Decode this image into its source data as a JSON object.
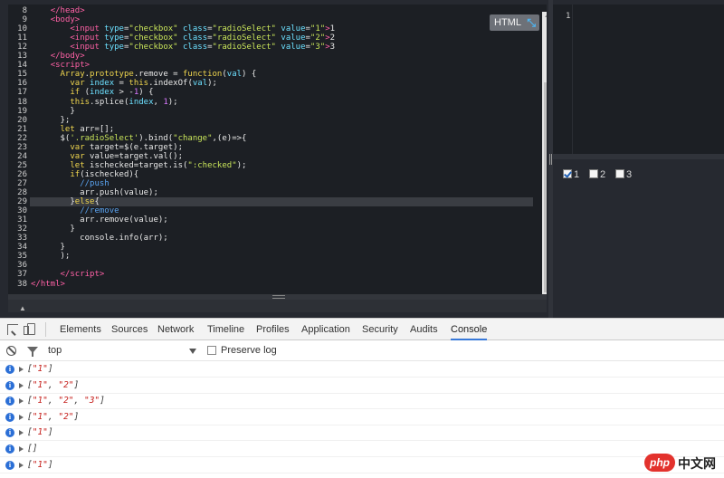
{
  "editor": {
    "lines": [
      {
        "n": "8",
        "html": "    <span class=\"t\">&lt;/head&gt;</span>"
      },
      {
        "n": "9",
        "html": "    <span class=\"t\">&lt;body&gt;</span>"
      },
      {
        "n": "10",
        "html": "        <span class=\"t\">&lt;input</span> <span class=\"a\">type</span>=<span class=\"s\">\"checkbox\"</span> <span class=\"a\">class</span>=<span class=\"s\">\"radioSelect\"</span> <span class=\"a\">value</span>=<span class=\"s\">\"1\"</span><span class=\"t\">&gt;</span>1"
      },
      {
        "n": "11",
        "html": "        <span class=\"t\">&lt;input</span> <span class=\"a\">type</span>=<span class=\"s\">\"checkbox\"</span> <span class=\"a\">class</span>=<span class=\"s\">\"radioSelect\"</span> <span class=\"a\">value</span>=<span class=\"s\">\"2\"</span><span class=\"t\">&gt;</span>2"
      },
      {
        "n": "12",
        "html": "        <span class=\"t\">&lt;input</span> <span class=\"a\">type</span>=<span class=\"s\">\"checkbox\"</span> <span class=\"a\">class</span>=<span class=\"s\">\"radioSelect\"</span> <span class=\"a\">value</span>=<span class=\"s\">\"3\"</span><span class=\"t\">&gt;</span>3"
      },
      {
        "n": "13",
        "html": "    <span class=\"t\">&lt;/body&gt;</span>"
      },
      {
        "n": "14",
        "html": "    <span class=\"t\">&lt;script&gt;</span>"
      },
      {
        "n": "15",
        "html": "      <span class=\"k\">Array</span>.<span class=\"k\">prototype</span>.remove = <span class=\"k\">function</span>(<span class=\"a\">val</span>) {"
      },
      {
        "n": "16",
        "html": "        <span class=\"k\">var</span> <span class=\"a\">index</span> = <span class=\"k\">this</span>.indexOf(<span class=\"a\">val</span>);"
      },
      {
        "n": "17",
        "html": "        <span class=\"k\">if</span> (<span class=\"a\">index</span> &gt; -<span class=\"nm\">1</span>) {"
      },
      {
        "n": "18",
        "html": "        <span class=\"k\">this</span>.splice(<span class=\"a\">index</span>, <span class=\"nm\">1</span>);"
      },
      {
        "n": "19",
        "html": "        }"
      },
      {
        "n": "20",
        "html": "      };"
      },
      {
        "n": "21",
        "html": "      <span class=\"k\">let</span> arr=[];"
      },
      {
        "n": "22",
        "html": "      $(<span class=\"s\">'.radioSelect'</span>).bind(<span class=\"s\">\"change\"</span>,(e)=&gt;{"
      },
      {
        "n": "23",
        "html": "        <span class=\"k\">var</span> target=$(e.target);"
      },
      {
        "n": "24",
        "html": "        <span class=\"k\">var</span> value=target.val();"
      },
      {
        "n": "25",
        "html": "        <span class=\"k\">let</span> ischecked=target.is(<span class=\"s\">\":checked\"</span>);"
      },
      {
        "n": "26",
        "html": "        <span class=\"k\">if</span>(ischecked){"
      },
      {
        "n": "27",
        "html": "          <span class=\"cm\">//push</span>"
      },
      {
        "n": "28",
        "html": "          arr.push(value);"
      },
      {
        "n": "29",
        "html": "        }<span class=\"k\">else</span>{",
        "active": true
      },
      {
        "n": "30",
        "html": "          <span class=\"cm\">//remove</span>"
      },
      {
        "n": "31",
        "html": "          arr.remove(value);"
      },
      {
        "n": "32",
        "html": "        }"
      },
      {
        "n": "33",
        "html": "          console.info(arr);"
      },
      {
        "n": "34",
        "html": "      }"
      },
      {
        "n": "35",
        "html": "      );"
      },
      {
        "n": "36",
        "html": ""
      },
      {
        "n": "37",
        "html": "      <span class=\"t\">&lt;/script&gt;</span>"
      },
      {
        "n": "38",
        "html": "<span class=\"t\">&lt;/html&gt;</span>"
      }
    ],
    "badge_label": "HTML",
    "badge_icon": "expand-icon",
    "right_line_number": "1"
  },
  "result": {
    "checkboxes": [
      {
        "label": "1",
        "checked": true
      },
      {
        "label": "2",
        "checked": false
      },
      {
        "label": "3",
        "checked": false
      }
    ]
  },
  "devtools": {
    "tabs": [
      "Elements",
      "Sources",
      "Network",
      "Timeline",
      "Profiles",
      "Application",
      "Security",
      "Audits",
      "Console"
    ],
    "active_tab": "Console",
    "context": "top",
    "preserve_log_label": "Preserve log",
    "accent_color": "#3879d9",
    "log": [
      [
        "\"1\""
      ],
      [
        "\"1\"",
        "\"2\""
      ],
      [
        "\"1\"",
        "\"2\"",
        "\"3\""
      ],
      [
        "\"1\"",
        "\"2\""
      ],
      [
        "\"1\""
      ],
      [],
      [
        "\"1\""
      ]
    ]
  },
  "watermark": {
    "logo": "php",
    "text": "中文网"
  }
}
